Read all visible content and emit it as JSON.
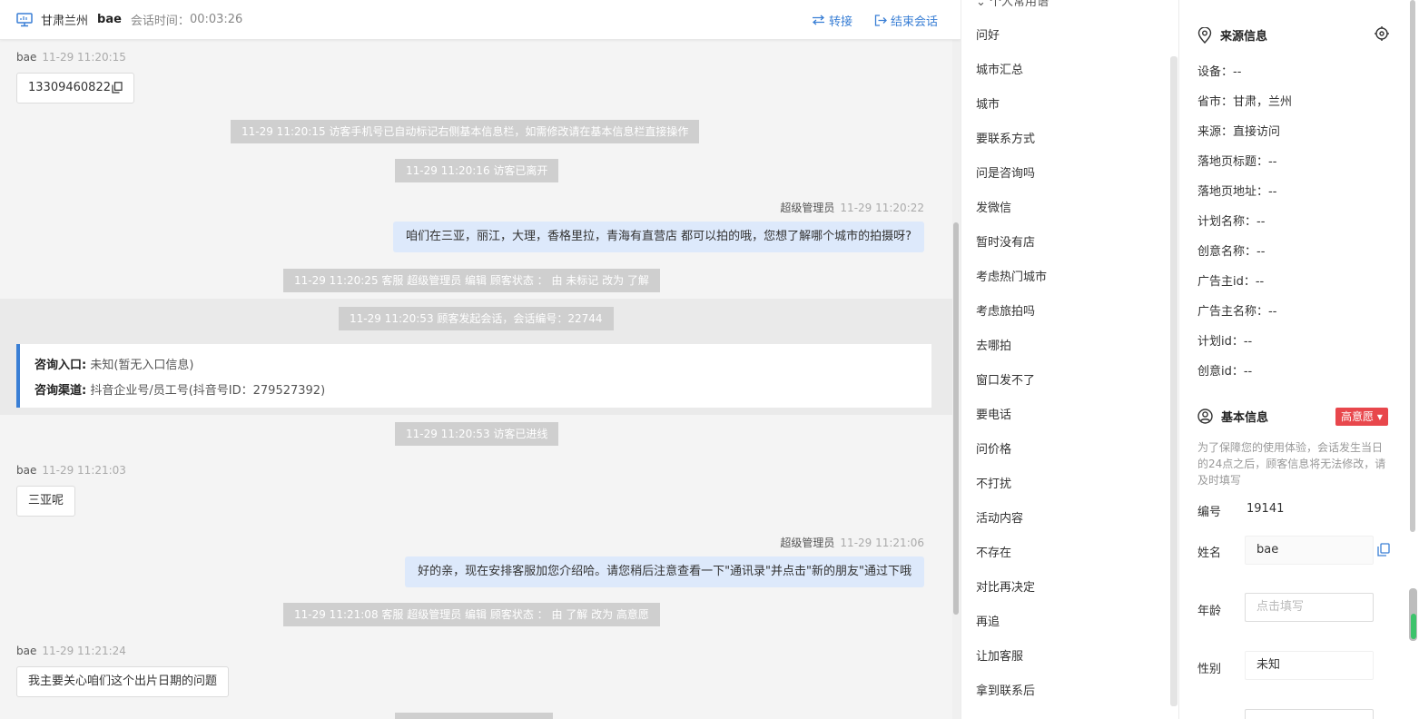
{
  "header": {
    "location": "甘肃兰州",
    "visitor_name": "bae",
    "session_time_label": "会话时间：",
    "session_time": "00:03:26",
    "transfer_label": "转接",
    "end_label": "结束会话"
  },
  "messages": {
    "m1_name": "bae",
    "m1_time": "11-29 11:20:15",
    "m1_text": "13309460822",
    "s1": "11-29 11:20:15 访客手机号已自动标记右侧基本信息栏，如需修改请在基本信息栏直接操作",
    "s2": "11-29 11:20:16 访客已离开",
    "m2_name": "超级管理员",
    "m2_time": "11-29 11:20:22",
    "m2_text": "咱们在三亚，丽江，大理，香格里拉，青海有直营店 都可以拍的哦，您想了解哪个城市的拍摄呀?",
    "s3": "11-29 11:20:25 客服 超级管理员 编辑 顾客状态 ： 由 未标记 改为 了解",
    "s4": "11-29 11:20:53 顾客发起会话，会话编号：22744",
    "entry_label": "咨询入口:",
    "entry_value": "未知(暂无入口信息)",
    "channel_label": "咨询渠道:",
    "channel_value": "抖音企业号/员工号(抖音号ID：279527392)",
    "s5": "11-29 11:20:53 访客已进线",
    "m3_name": "bae",
    "m3_time": "11-29 11:21:03",
    "m3_text": "三亚呢",
    "m4_name": "超级管理员",
    "m4_time": "11-29 11:21:06",
    "m4_text": "好的亲，现在安排客服加您介绍哈。请您稍后注意查看一下\"通讯录\"并点击\"新的朋友\"通过下哦",
    "s6": "11-29 11:21:08 客服 超级管理员 编辑 顾客状态 ： 由 了解 改为 高意愿",
    "m5_name": "bae",
    "m5_time": "11-29 11:21:24",
    "m5_text": "我主要关心咱们这个出片日期的问题"
  },
  "quick_replies": {
    "heading": "个人常用语",
    "items": [
      "问好",
      "城市汇总",
      "城市",
      "要联系方式",
      "问是咨询吗",
      "发微信",
      "暂时没有店",
      "考虑热门城市",
      "考虑旅拍吗",
      "去哪拍",
      "窗口发不了",
      "要电话",
      "问价格",
      "不打扰",
      "活动内容",
      "不存在",
      "对比再决定",
      "再追",
      "让加客服",
      "拿到联系后"
    ]
  },
  "source_info": {
    "title": "来源信息",
    "rows": [
      "设备：--",
      "省市：甘肃，兰州",
      "来源：直接访问",
      "落地页标题：--",
      "落地页地址：--",
      "计划名称：--",
      "创意名称：--",
      "广告主id：--",
      "广告主名称：--",
      "计划id：--",
      "创意id：--"
    ]
  },
  "basic_info": {
    "title": "基本信息",
    "intent_badge": "高意愿",
    "note": "为了保障您的使用体验，会话发生当日的24点之后，顾客信息将无法修改，请及时填写",
    "id_label": "编号",
    "id_value": "19141",
    "name_label": "姓名",
    "name_value": "bae",
    "age_label": "年龄",
    "age_placeholder": "点击填写",
    "gender_label": "性别",
    "gender_value": "未知"
  },
  "colors": {
    "accent": "#3a7fd5",
    "badge": "#e8474c",
    "agent_bubble": "#dde9fb",
    "system_bg": "#cfcfcf"
  }
}
